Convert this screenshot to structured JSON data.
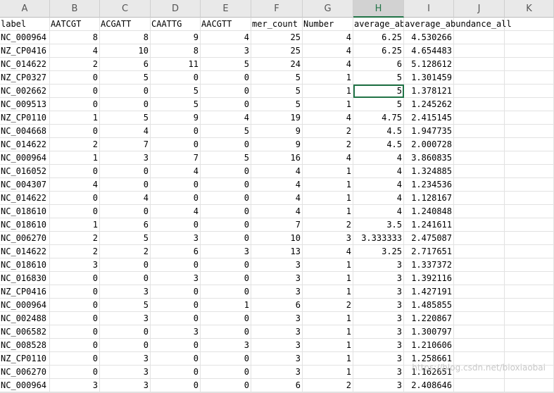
{
  "sheet": {
    "column_letters": [
      "A",
      "B",
      "C",
      "D",
      "E",
      "F",
      "G",
      "H",
      "I",
      "J",
      "K"
    ],
    "active_column": "H",
    "header_row": [
      "label",
      "AATCGT",
      "ACGATT",
      "CAATTG",
      "AACGTT",
      "mer_count",
      "Number",
      "average_abundance",
      "average_abundance_all",
      "",
      ""
    ],
    "rows": [
      [
        "NC_000964",
        "8",
        "8",
        "9",
        "4",
        "25",
        "4",
        "6.25",
        "4.530266"
      ],
      [
        "NZ_CP0416",
        "4",
        "10",
        "8",
        "3",
        "25",
        "4",
        "6.25",
        "4.654483"
      ],
      [
        "NC_014622",
        "2",
        "6",
        "11",
        "5",
        "24",
        "4",
        "6",
        "5.128612"
      ],
      [
        "NZ_CP0327",
        "0",
        "5",
        "0",
        "0",
        "5",
        "1",
        "5",
        "1.301459"
      ],
      [
        "NC_002662",
        "0",
        "0",
        "5",
        "0",
        "5",
        "1",
        "5",
        "1.378121"
      ],
      [
        "NC_009513",
        "0",
        "0",
        "5",
        "0",
        "5",
        "1",
        "5",
        "1.245262"
      ],
      [
        "NZ_CP0110",
        "1",
        "5",
        "9",
        "4",
        "19",
        "4",
        "4.75",
        "2.415145"
      ],
      [
        "NC_004668",
        "0",
        "4",
        "0",
        "5",
        "9",
        "2",
        "4.5",
        "1.947735"
      ],
      [
        "NC_014622",
        "2",
        "7",
        "0",
        "0",
        "9",
        "2",
        "4.5",
        "2.000728"
      ],
      [
        "NC_000964",
        "1",
        "3",
        "7",
        "5",
        "16",
        "4",
        "4",
        "3.860835"
      ],
      [
        "NC_016052",
        "0",
        "0",
        "4",
        "0",
        "4",
        "1",
        "4",
        "1.324885"
      ],
      [
        "NC_004307",
        "4",
        "0",
        "0",
        "0",
        "4",
        "1",
        "4",
        "1.234536"
      ],
      [
        "NC_014622",
        "0",
        "4",
        "0",
        "0",
        "4",
        "1",
        "4",
        "1.128167"
      ],
      [
        "NC_018610",
        "0",
        "0",
        "4",
        "0",
        "4",
        "1",
        "4",
        "1.240848"
      ],
      [
        "NC_018610",
        "1",
        "6",
        "0",
        "0",
        "7",
        "2",
        "3.5",
        "1.241611"
      ],
      [
        "NC_006270",
        "2",
        "5",
        "3",
        "0",
        "10",
        "3",
        "3.333333",
        "2.475087"
      ],
      [
        "NC_014622",
        "2",
        "2",
        "6",
        "3",
        "13",
        "4",
        "3.25",
        "2.717651"
      ],
      [
        "NC_018610",
        "3",
        "0",
        "0",
        "0",
        "3",
        "1",
        "3",
        "1.337372"
      ],
      [
        "NC_016830",
        "0",
        "0",
        "3",
        "0",
        "3",
        "1",
        "3",
        "1.392116"
      ],
      [
        "NZ_CP0416",
        "0",
        "3",
        "0",
        "0",
        "3",
        "1",
        "3",
        "1.427191"
      ],
      [
        "NC_000964",
        "0",
        "5",
        "0",
        "1",
        "6",
        "2",
        "3",
        "1.485855"
      ],
      [
        "NC_002488",
        "0",
        "3",
        "0",
        "0",
        "3",
        "1",
        "3",
        "1.220867"
      ],
      [
        "NC_006582",
        "0",
        "0",
        "3",
        "0",
        "3",
        "1",
        "3",
        "1.300797"
      ],
      [
        "NC_008528",
        "0",
        "0",
        "0",
        "3",
        "3",
        "1",
        "3",
        "1.210606"
      ],
      [
        "NZ_CP0110",
        "0",
        "3",
        "0",
        "0",
        "3",
        "1",
        "3",
        "1.258661"
      ],
      [
        "NC_006270",
        "0",
        "3",
        "0",
        "0",
        "3",
        "1",
        "3",
        "1.162651"
      ],
      [
        "NC_000964",
        "3",
        "3",
        "0",
        "0",
        "6",
        "2",
        "3",
        "2.408646"
      ]
    ],
    "selected_cell": {
      "row": 5,
      "col": 7
    }
  },
  "watermark": "https://blog.csdn.net/bioxiaobai",
  "colors": {
    "selection": "#217346",
    "header_bg": "#e9e9e9",
    "header_active_bg": "#d2d2d2",
    "grid_line": "#e2e2e2"
  }
}
